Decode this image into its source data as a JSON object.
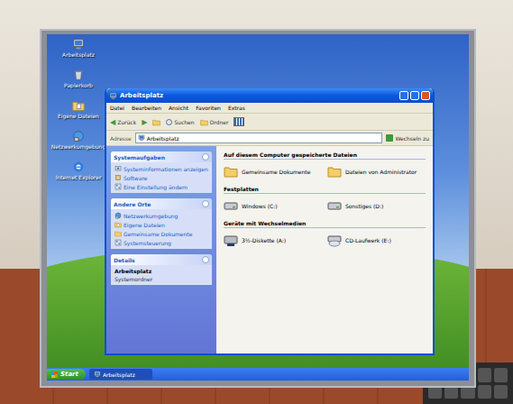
{
  "desktop": {
    "icons": [
      {
        "label": "Arbeitsplatz",
        "kind": "computer"
      },
      {
        "label": "Papierkorb",
        "kind": "bin"
      },
      {
        "label": "Eigene Dateien",
        "kind": "documents"
      },
      {
        "label": "Netzwerkumgebung",
        "kind": "network"
      },
      {
        "label": "Internet Explorer",
        "kind": "ie"
      }
    ]
  },
  "window": {
    "title": "Arbeitsplatz",
    "menu": [
      "Datei",
      "Bearbeiten",
      "Ansicht",
      "Favoriten",
      "Extras"
    ],
    "toolbar": {
      "back": "Zurück",
      "search": "Suchen",
      "folders": "Ordner"
    },
    "address": {
      "label": "Adresse",
      "value": "Arbeitsplatz",
      "go": "Wechseln zu"
    },
    "sidebar": {
      "panels": [
        {
          "title": "Systemaufgaben",
          "expanded": true,
          "kind": "links",
          "items": [
            {
              "label": "Systeminformationen anzeigen",
              "kind": "info"
            },
            {
              "label": "Software",
              "kind": "software"
            },
            {
              "label": "Eine Einstellung ändern",
              "kind": "settings"
            }
          ]
        },
        {
          "title": "Andere Orte",
          "expanded": true,
          "kind": "links",
          "items": [
            {
              "label": "Netzwerkumgebung",
              "kind": "network"
            },
            {
              "label": "Eigene Dateien",
              "kind": "documents"
            },
            {
              "label": "Gemeinsame Dokumente",
              "kind": "folder"
            },
            {
              "label": "Systemsteuerung",
              "kind": "control"
            }
          ]
        },
        {
          "title": "Details",
          "expanded": true,
          "kind": "details",
          "items": [
            {
              "label": "Arbeitsplatz",
              "kind": "name"
            },
            {
              "label": "Systemordner",
              "kind": "type"
            }
          ]
        }
      ]
    },
    "content": {
      "groups": [
        {
          "title": "Auf diesem Computer gespeicherte Dateien",
          "items": [
            {
              "label": "Gemeinsame Dokumente",
              "kind": "folder"
            },
            {
              "label": "Dateien von Administrator",
              "kind": "folder"
            }
          ]
        },
        {
          "title": "Festplatten",
          "items": [
            {
              "label": "Windows (C:)",
              "kind": "hdd"
            },
            {
              "label": "Sonstiges (D:)",
              "kind": "hdd"
            }
          ]
        },
        {
          "title": "Geräte mit Wechselmedien",
          "items": [
            {
              "label": "3½-Diskette (A:)",
              "kind": "floppy"
            },
            {
              "label": "CD-Laufwerk (E:)",
              "kind": "cd"
            }
          ]
        }
      ]
    }
  },
  "taskbar": {
    "start": "Start",
    "tasks": [
      {
        "label": "Arbeitsplatz",
        "selected": true
      }
    ]
  }
}
